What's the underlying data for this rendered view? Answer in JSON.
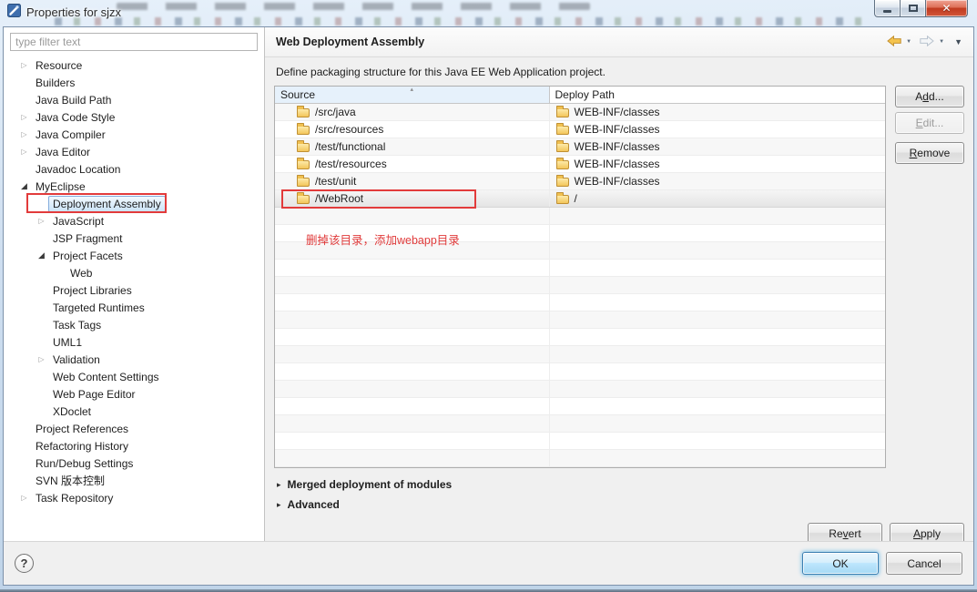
{
  "window": {
    "title": "Properties for sjzx"
  },
  "icons": {
    "dropdown": "▼",
    "section_arrow": "▸",
    "sort_asc": "▴",
    "collapsed_arrow": "▷",
    "expanded_arrow": "◢",
    "close": "✕"
  },
  "sidebar": {
    "filter_placeholder": "type filter text",
    "items": [
      {
        "label": "Resource",
        "indent": 0,
        "arrow": "collapsed"
      },
      {
        "label": "Builders",
        "indent": 0,
        "arrow": "none"
      },
      {
        "label": "Java Build Path",
        "indent": 0,
        "arrow": "none"
      },
      {
        "label": "Java Code Style",
        "indent": 0,
        "arrow": "collapsed"
      },
      {
        "label": "Java Compiler",
        "indent": 0,
        "arrow": "collapsed"
      },
      {
        "label": "Java Editor",
        "indent": 0,
        "arrow": "collapsed"
      },
      {
        "label": "Javadoc Location",
        "indent": 0,
        "arrow": "none"
      },
      {
        "label": "MyEclipse",
        "indent": 0,
        "arrow": "expanded"
      },
      {
        "label": "Deployment Assembly",
        "indent": 1,
        "arrow": "none",
        "selected": true,
        "red_box": true
      },
      {
        "label": "JavaScript",
        "indent": 1,
        "arrow": "collapsed"
      },
      {
        "label": "JSP Fragment",
        "indent": 1,
        "arrow": "none"
      },
      {
        "label": "Project Facets",
        "indent": 1,
        "arrow": "expanded"
      },
      {
        "label": "Web",
        "indent": 2,
        "arrow": "none"
      },
      {
        "label": "Project Libraries",
        "indent": 1,
        "arrow": "none"
      },
      {
        "label": "Targeted Runtimes",
        "indent": 1,
        "arrow": "none"
      },
      {
        "label": "Task Tags",
        "indent": 1,
        "arrow": "none"
      },
      {
        "label": "UML1",
        "indent": 1,
        "arrow": "none"
      },
      {
        "label": "Validation",
        "indent": 1,
        "arrow": "collapsed"
      },
      {
        "label": "Web Content Settings",
        "indent": 1,
        "arrow": "none"
      },
      {
        "label": "Web Page Editor",
        "indent": 1,
        "arrow": "none"
      },
      {
        "label": "XDoclet",
        "indent": 1,
        "arrow": "none"
      },
      {
        "label": "Project References",
        "indent": 0,
        "arrow": "none"
      },
      {
        "label": "Refactoring History",
        "indent": 0,
        "arrow": "none"
      },
      {
        "label": "Run/Debug Settings",
        "indent": 0,
        "arrow": "none"
      },
      {
        "label": "SVN 版本控制",
        "indent": 0,
        "arrow": "none"
      },
      {
        "label": "Task Repository",
        "indent": 0,
        "arrow": "collapsed"
      }
    ]
  },
  "main": {
    "title": "Web Deployment Assembly",
    "description": "Define packaging structure for this Java EE Web Application project.",
    "table": {
      "columns": [
        "Source",
        "Deploy Path"
      ],
      "rows": [
        {
          "source": "/src/java",
          "deploy": "WEB-INF/classes"
        },
        {
          "source": "/src/resources",
          "deploy": "WEB-INF/classes"
        },
        {
          "source": "/test/functional",
          "deploy": "WEB-INF/classes"
        },
        {
          "source": "/test/resources",
          "deploy": "WEB-INF/classes"
        },
        {
          "source": "/test/unit",
          "deploy": "WEB-INF/classes"
        },
        {
          "source": "/WebRoot",
          "deploy": "/",
          "selected": true,
          "red_box": true
        }
      ],
      "empty_rows": 15
    },
    "annotation": "删掉该目录，添加webapp目录",
    "buttons": {
      "add": {
        "label": "Add...",
        "u": 1
      },
      "edit": {
        "label": "Edit...",
        "u": 0
      },
      "remove": {
        "label": "Remove",
        "u": 0
      }
    },
    "sections": [
      "Merged deployment of modules",
      "Advanced"
    ],
    "actions": {
      "revert": {
        "label": "Revert",
        "u": 2
      },
      "apply": {
        "label": "Apply",
        "u": 0
      }
    }
  },
  "footer": {
    "help": "?",
    "ok": "OK",
    "cancel": "Cancel"
  },
  "colors": {
    "annotation_red": "#e23b3b",
    "tree_selection_blue": "#cbe4f8",
    "default_button_blue": "#bde6fd",
    "folder_gold": "#f3c65a",
    "source_header_blue": "#e6f1fb",
    "close_button_red": "#c03a20"
  }
}
